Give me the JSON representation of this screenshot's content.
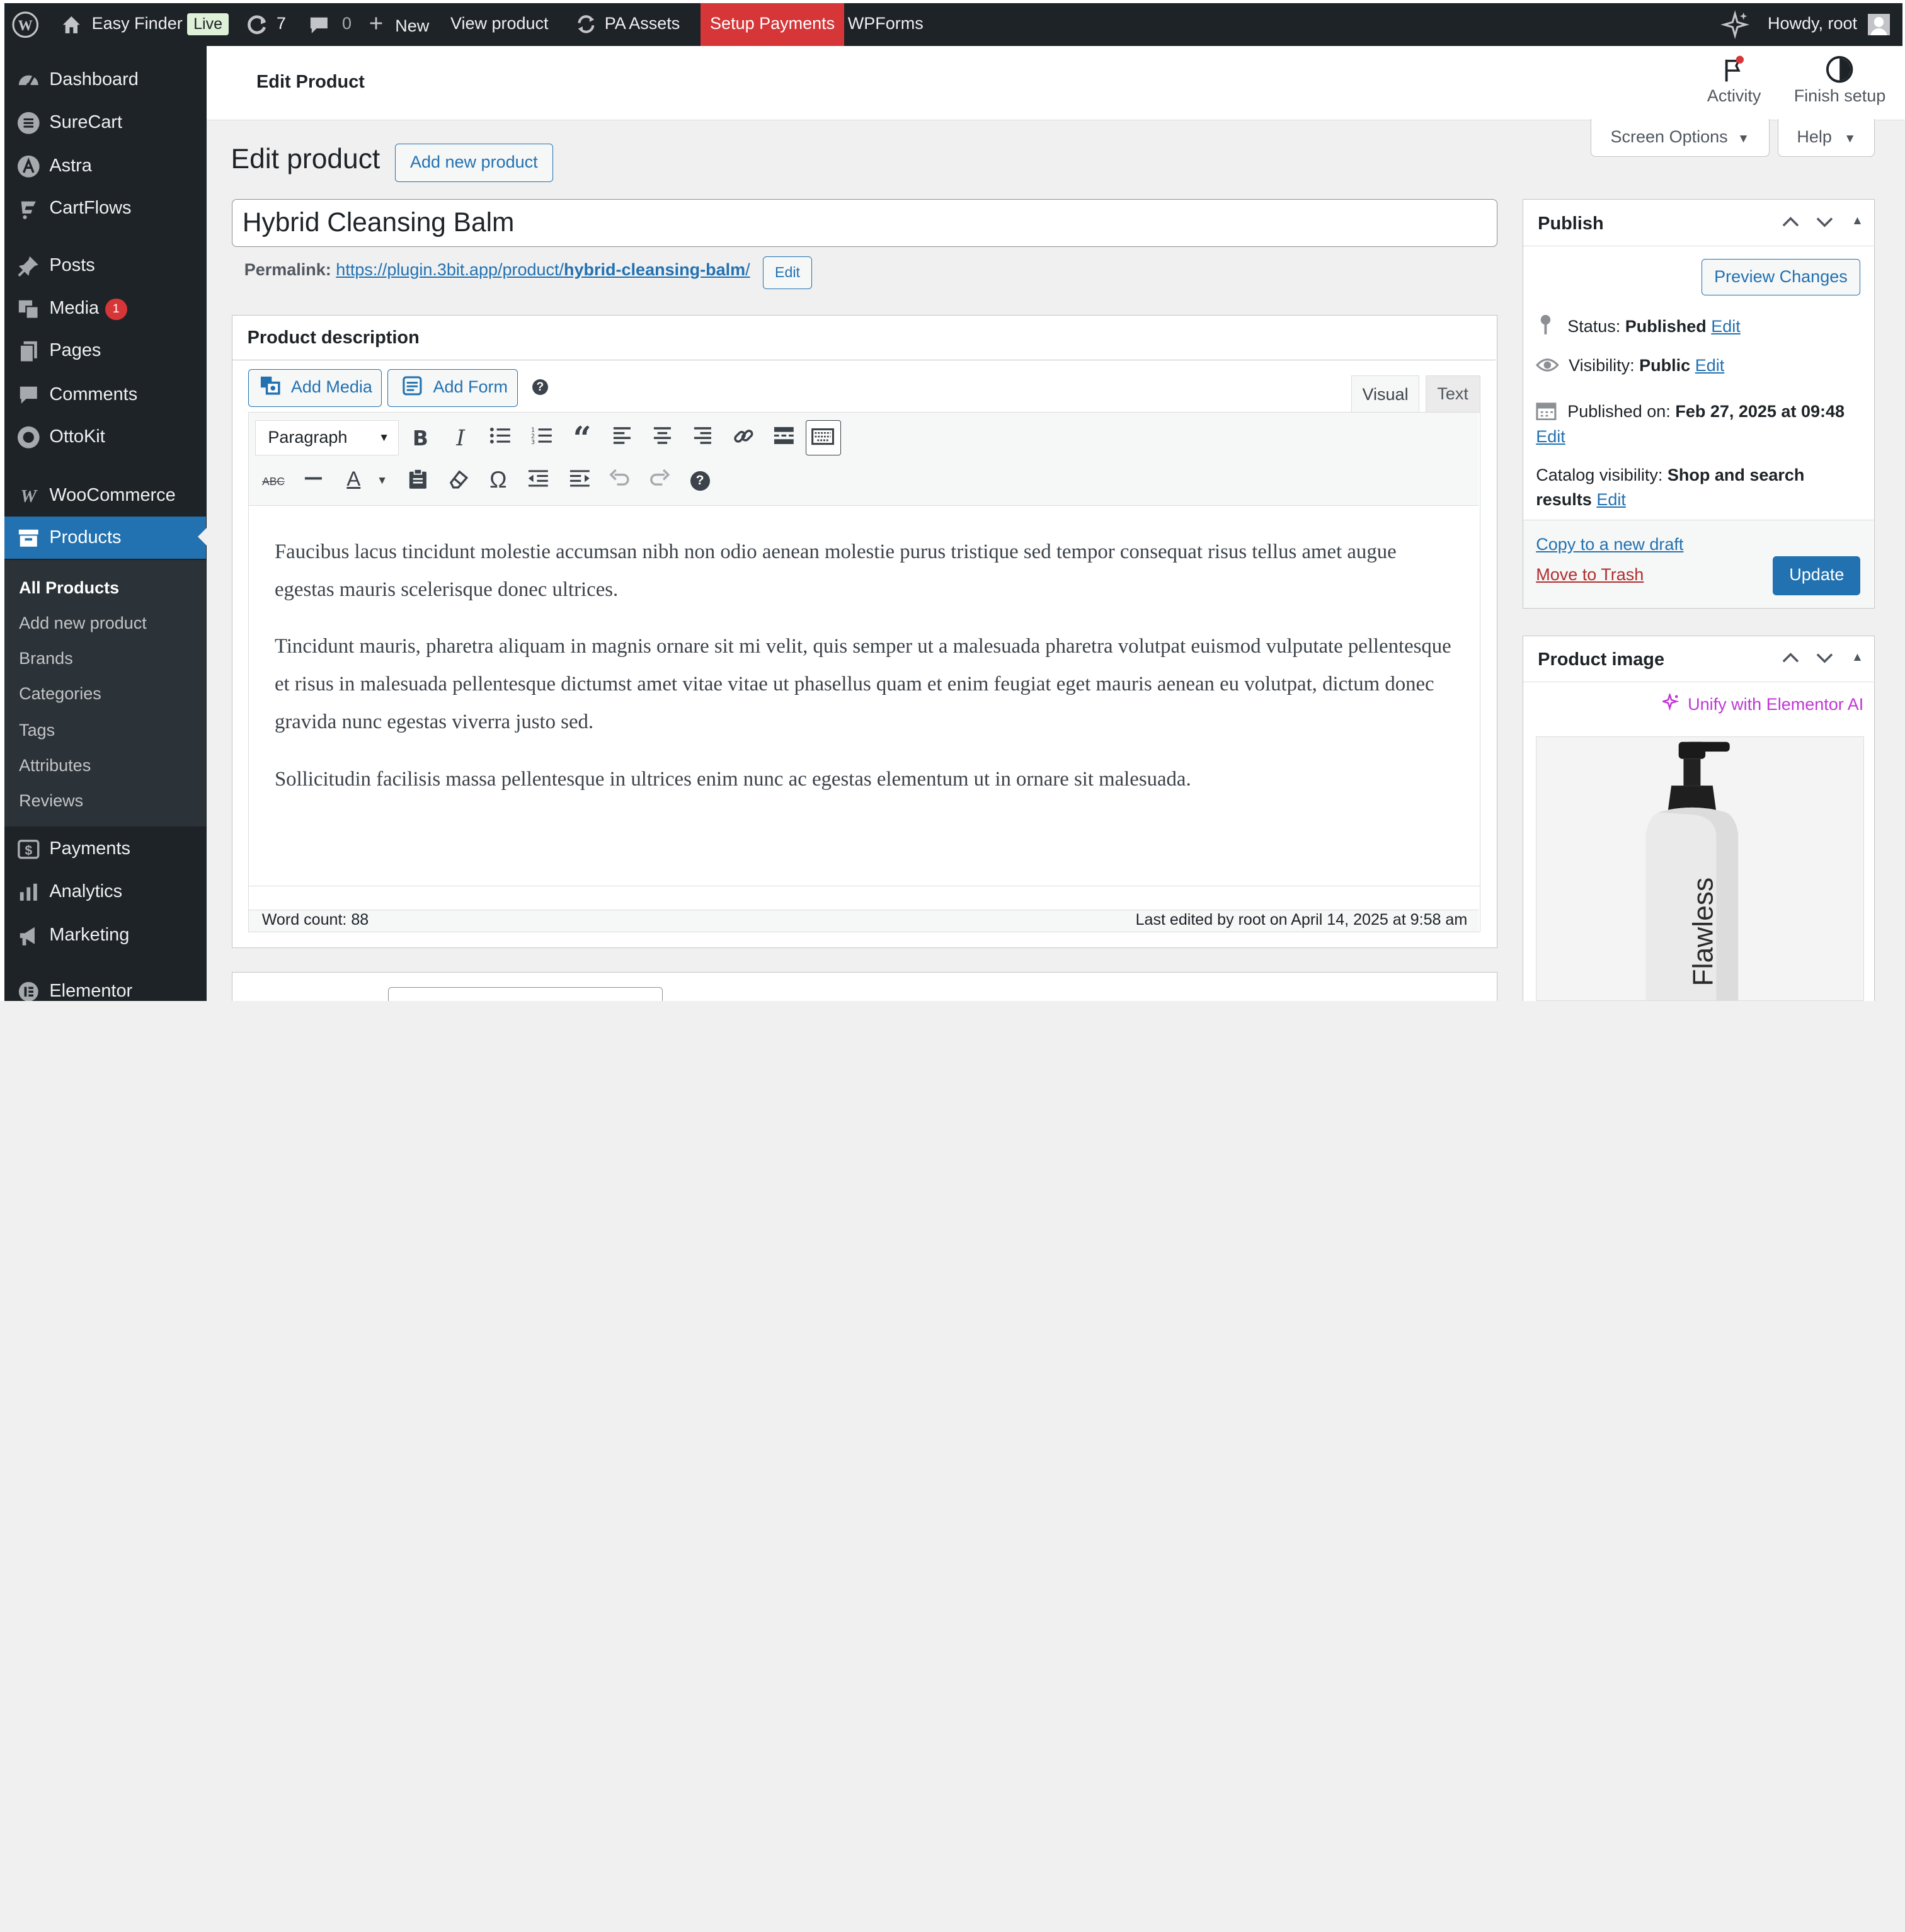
{
  "admin_bar": {
    "site_name": "Easy Finder",
    "live_badge": "Live",
    "updates_count": "7",
    "comments_count": "0",
    "new_label": "New",
    "view_product": "View product",
    "pa_assets": "PA Assets",
    "setup_payments": "Setup Payments",
    "wpforms": "WPForms",
    "howdy": "Howdy, root"
  },
  "sidebar": {
    "items": [
      {
        "label": "Dashboard",
        "icon": "dashboard-icon"
      },
      {
        "label": "SureCart",
        "icon": "surecart-icon"
      },
      {
        "label": "Astra",
        "icon": "astra-icon"
      },
      {
        "label": "CartFlows",
        "icon": "cartflows-icon"
      },
      {
        "label": "Posts",
        "icon": "pin-icon"
      },
      {
        "label": "Media",
        "icon": "media-icon",
        "badge": "1"
      },
      {
        "label": "Pages",
        "icon": "pages-icon"
      },
      {
        "label": "Comments",
        "icon": "comment-icon"
      },
      {
        "label": "OttoKit",
        "icon": "ottokit-icon"
      },
      {
        "label": "WooCommerce",
        "icon": "woo-icon"
      },
      {
        "label": "Products",
        "icon": "archive-icon"
      },
      {
        "label": "Payments",
        "icon": "dollar-icon"
      },
      {
        "label": "Analytics",
        "icon": "chart-bar-icon"
      },
      {
        "label": "Marketing",
        "icon": "megaphone-icon"
      },
      {
        "label": "Elementor",
        "icon": "elementor-icon"
      }
    ],
    "submenu": [
      "All Products",
      "Add new product",
      "Brands",
      "Categories",
      "Tags",
      "Attributes",
      "Reviews"
    ]
  },
  "header": {
    "title": "Edit Product",
    "activity": "Activity",
    "finish_setup": "Finish setup",
    "screen_options": "Screen Options",
    "help": "Help"
  },
  "page": {
    "heading": "Edit product",
    "add_new": "Add new product",
    "product_title": "Hybrid Cleansing Balm",
    "permalink_label": "Permalink:",
    "permalink_base": "https://plugin.3bit.app/product/",
    "permalink_slug": "hybrid-cleansing-balm",
    "permalink_end": "/",
    "permalink_edit": "Edit"
  },
  "editor": {
    "section_title": "Product description",
    "add_media": "Add Media",
    "add_form": "Add Form",
    "tab_visual": "Visual",
    "tab_text": "Text",
    "format": "Paragraph",
    "paragraphs": [
      "Faucibus lacus tincidunt molestie accumsan nibh non odio aenean molestie purus tristique sed tempor consequat risus tellus amet augue egestas mauris scelerisque donec ultrices.",
      "Tincidunt mauris, pharetra aliquam in magnis ornare sit mi velit, quis semper ut a malesuada pharetra volutpat euismod vulputate pellentesque et risus in malesuada pellentesque dictumst amet vitae vitae ut phasellus quam et enim feugiat eget mauris aenean eu volutpat, dictum donec gravida nunc egestas viverra justo sed.",
      "Sollicitudin facilisis massa pellentesque in ultrices enim nunc ac egestas elementum ut in ornare sit malesuada."
    ],
    "word_count": "Word count: 88",
    "last_edited": "Last edited by root on April 14, 2025 at 9:58 am"
  },
  "publish": {
    "title": "Publish",
    "preview": "Preview Changes",
    "status_label": "Status:",
    "status_value": "Published",
    "visibility_label": "Visibility:",
    "visibility_value": "Public",
    "published_label": "Published on:",
    "published_value": "Feb 27, 2025 at 09:48",
    "catalog_label": "Catalog visibility:",
    "catalog_value_1": "Shop and search",
    "catalog_value_2": "results",
    "edit": "Edit",
    "copy_draft": "Copy to a new draft",
    "trash": "Move to Trash",
    "update": "Update"
  },
  "product_image": {
    "title": "Product image",
    "elementor_ai": "Unify with Elementor AI",
    "bottle_text": "Flawless"
  },
  "colors": {
    "accent": "#2271b1",
    "admin_dark": "#1d2327",
    "danger": "#d63638",
    "elementor": "#c036d6"
  }
}
